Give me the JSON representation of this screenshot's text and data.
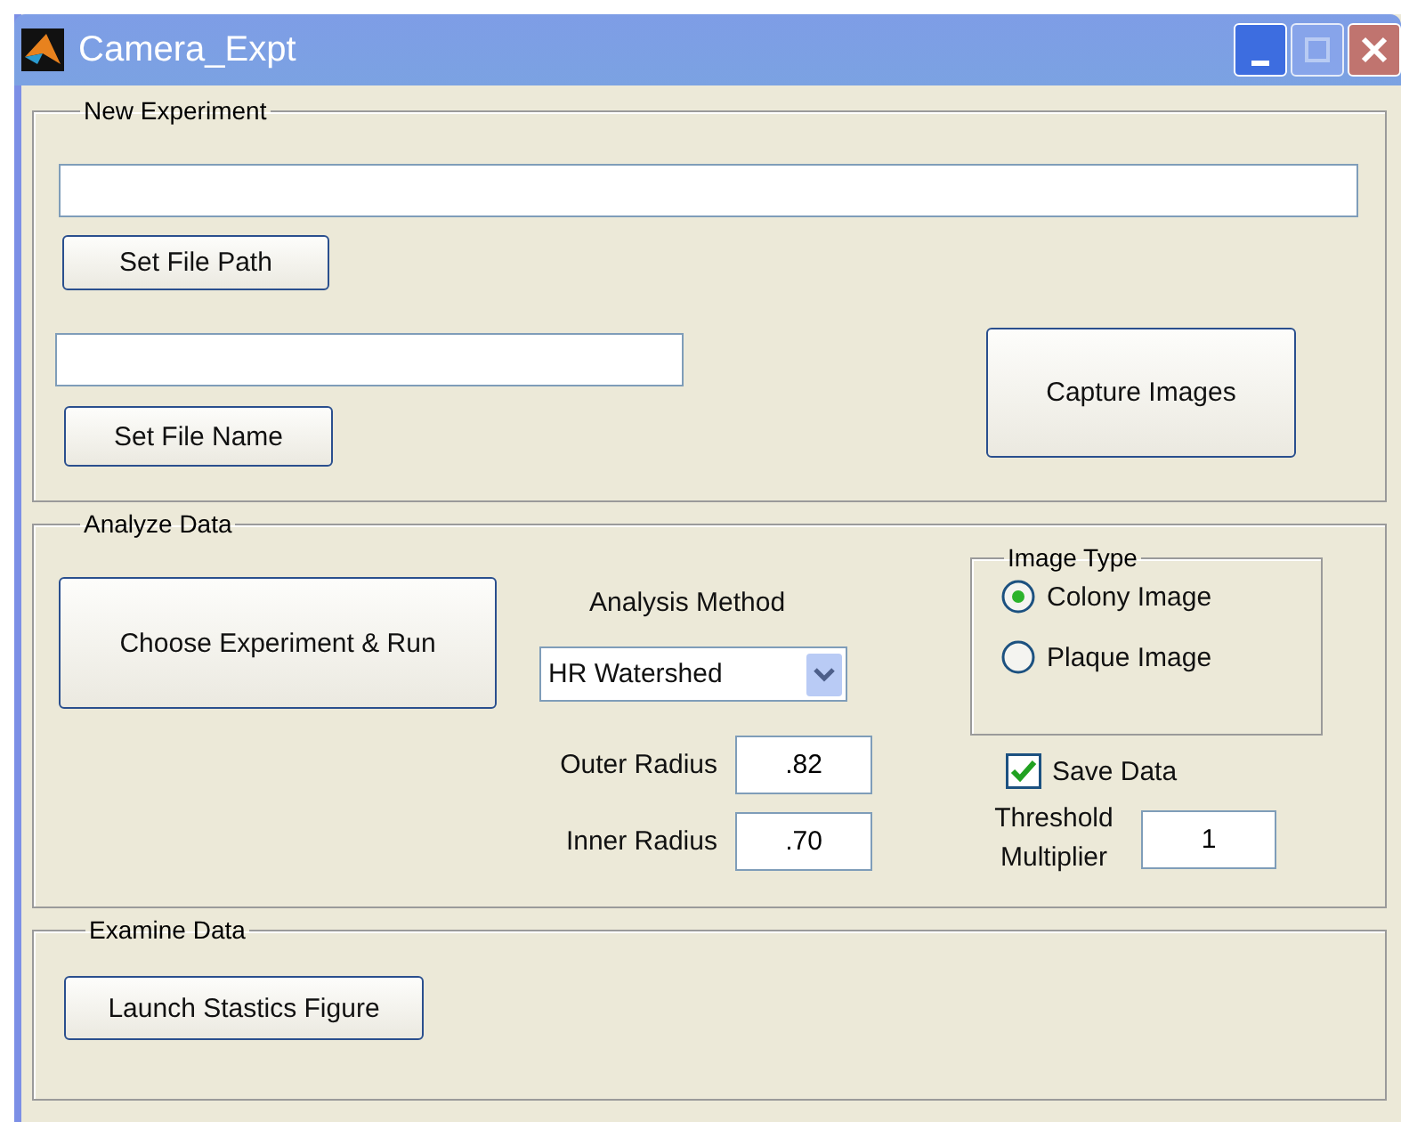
{
  "window": {
    "title": "Camera_Expt"
  },
  "new_experiment": {
    "title": "New Experiment",
    "set_path_button": "Set File Path",
    "set_name_button": "Set File Name",
    "capture_button": "Capture Images"
  },
  "analyze_data": {
    "title": "Analyze Data",
    "run_button": "Choose Experiment & Run",
    "method_label": "Analysis Method",
    "method_select": {
      "value": "HR Watershed"
    },
    "params": [
      {
        "label": "Outer Radius",
        "value": ".82"
      },
      {
        "label": "Inner Radius",
        "value": ".70"
      }
    ],
    "image_type": {
      "title": "Image Type",
      "options": [
        {
          "label": "Colony Image",
          "selected": true
        },
        {
          "label": "Plaque Image",
          "selected": false
        }
      ]
    },
    "save_data": {
      "label": "Save Data",
      "checked": true
    },
    "threshold": {
      "label": "Threshold Multiplier",
      "value": "1"
    }
  },
  "examine_data": {
    "title": "Examine Data",
    "launch_button": "Launch Stastics Figure"
  }
}
